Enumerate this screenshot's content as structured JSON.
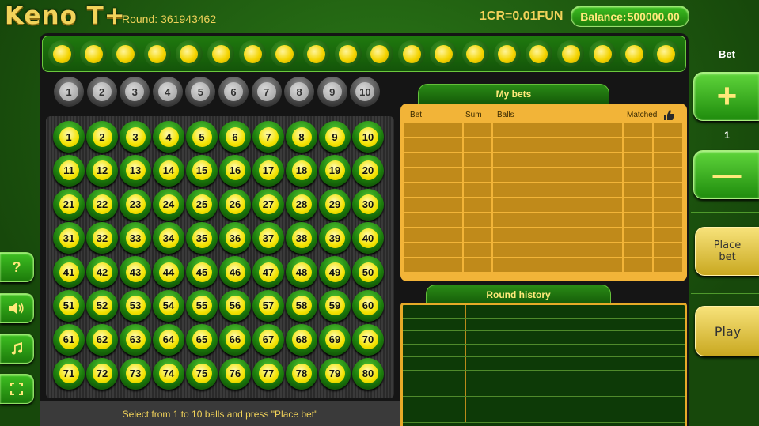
{
  "header": {
    "logo": "Keno T+",
    "round_label": "Round:",
    "round_value": "361943462",
    "rate": "1CR=0.01FUN",
    "balance_label": "Balance:",
    "balance_value": "500000.00"
  },
  "drawn_slots_count": 20,
  "selection_strip": [
    "1",
    "2",
    "3",
    "4",
    "5",
    "6",
    "7",
    "8",
    "9",
    "10"
  ],
  "board_numbers": [
    "1",
    "2",
    "3",
    "4",
    "5",
    "6",
    "7",
    "8",
    "9",
    "10",
    "11",
    "12",
    "13",
    "14",
    "15",
    "16",
    "17",
    "18",
    "19",
    "20",
    "21",
    "22",
    "23",
    "24",
    "25",
    "26",
    "27",
    "28",
    "29",
    "30",
    "31",
    "32",
    "33",
    "34",
    "35",
    "36",
    "37",
    "38",
    "39",
    "40",
    "41",
    "42",
    "43",
    "44",
    "45",
    "46",
    "47",
    "48",
    "49",
    "50",
    "51",
    "52",
    "53",
    "54",
    "55",
    "56",
    "57",
    "58",
    "59",
    "60",
    "61",
    "62",
    "63",
    "64",
    "65",
    "66",
    "67",
    "68",
    "69",
    "70",
    "71",
    "72",
    "73",
    "74",
    "75",
    "76",
    "77",
    "78",
    "79",
    "80"
  ],
  "hint": "Select from 1 to 10 balls and press \"Place bet\"",
  "my_bets": {
    "title": "My bets",
    "columns": {
      "bet": "Bet",
      "sum": "Sum",
      "balls": "Balls",
      "matched": "Matched"
    },
    "icons": {
      "thumb": "thumbs-up-icon"
    },
    "rows": 10
  },
  "round_history": {
    "title": "Round history",
    "rows": 9
  },
  "side_buttons": {
    "help": "?",
    "icons": {
      "sound": "speaker-icon",
      "music": "music-note-icon",
      "fullscreen": "fullscreen-icon"
    }
  },
  "controls": {
    "bet_label": "Bet",
    "plus": "+",
    "bet_value": "1",
    "minus": "—",
    "place_bet": "Place bet",
    "play": "Play"
  },
  "colors": {
    "gold": "#f2d35a",
    "green": "#1f7a0e",
    "ball_yellow": "#f3e300",
    "panel_orange": "#f2b438"
  }
}
